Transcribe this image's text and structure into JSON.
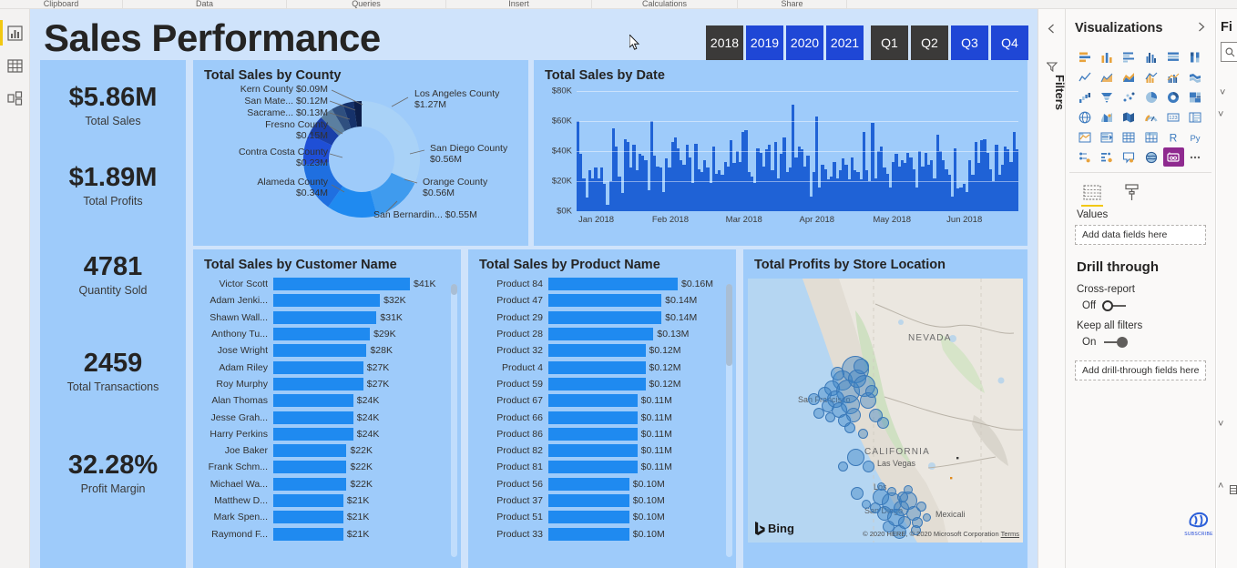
{
  "ribbon": {
    "groups": [
      "Clipboard",
      "Data",
      "Queries",
      "Insert",
      "Calculations",
      "Share"
    ]
  },
  "left_rail": {
    "items": [
      {
        "name": "report-view",
        "icon": "bar-chart-icon",
        "selected": true
      },
      {
        "name": "data-view",
        "icon": "table-icon",
        "selected": false
      },
      {
        "name": "model-view",
        "icon": "relationships-icon",
        "selected": false
      }
    ]
  },
  "report": {
    "title": "Sales Performance",
    "year_slicer": {
      "options": [
        "2018",
        "2019",
        "2020",
        "2021"
      ],
      "selected": [
        "2018"
      ]
    },
    "quarter_slicer": {
      "options": [
        "Q1",
        "Q2",
        "Q3",
        "Q4"
      ],
      "selected": [
        "Q1",
        "Q2"
      ]
    },
    "kpis": [
      {
        "value": "$5.86M",
        "label": "Total Sales"
      },
      {
        "value": "$1.89M",
        "label": "Total Profits"
      },
      {
        "value": "4781",
        "label": "Quantity Sold"
      },
      {
        "value": "2459",
        "label": "Total Transactions"
      },
      {
        "value": "32.28%",
        "label": "Profit Margin"
      }
    ]
  },
  "chart_data": [
    {
      "type": "pie",
      "title": "Total Sales by County",
      "labels": [
        "Los Angeles County",
        "San Diego County",
        "Orange County",
        "San Bernardin...",
        "Alameda County",
        "Contra Costa County",
        "Fresno County",
        "Sacrame...",
        "San Mate...",
        "Kern County"
      ],
      "value_labels": [
        "$1.27M",
        "$0.56M",
        "$0.56M",
        "$0.55M",
        "$0.34M",
        "$0.23M",
        "$0.15M",
        "$0.13M",
        "$0.12M",
        "$0.09M"
      ],
      "values": [
        1.27,
        0.56,
        0.56,
        0.55,
        0.34,
        0.23,
        0.15,
        0.13,
        0.12,
        0.09
      ],
      "unit": "M",
      "colors": [
        "#a9d2f7",
        "#3f9bee",
        "#1f8af0",
        "#1f6fe0",
        "#1f4fd6",
        "#1a3fa8",
        "#5b7fa0",
        "#2f4f7f",
        "#16326b",
        "#0d1f4a"
      ],
      "legend": "labels-outside"
    },
    {
      "type": "bar",
      "title": "Total Sales by Date",
      "xlabel": "",
      "ylabel": "",
      "ylim": [
        0,
        80000
      ],
      "ytick_labels": [
        "$0K",
        "$20K",
        "$40K",
        "$60K",
        "$80K"
      ],
      "ytick_values": [
        0,
        20000,
        40000,
        60000,
        80000
      ],
      "xtick_labels": [
        "Jan 2018",
        "Feb 2018",
        "Mar 2018",
        "Apr 2018",
        "May 2018",
        "Jun 2018"
      ],
      "grid": true,
      "bar_color": "#1f62d6",
      "values": [
        60000,
        38000,
        22000,
        9000,
        27000,
        22000,
        29000,
        22000,
        29000,
        18000,
        4000,
        20000,
        55000,
        43000,
        23000,
        12000,
        48000,
        46000,
        29000,
        44000,
        27000,
        38000,
        37000,
        34000,
        14000,
        60000,
        37000,
        30000,
        29000,
        13000,
        35000,
        29000,
        46000,
        49000,
        42000,
        34000,
        31000,
        44000,
        36000,
        19000,
        45000,
        28000,
        26000,
        34000,
        29000,
        19000,
        43000,
        25000,
        27000,
        24000,
        33000,
        30000,
        47000,
        32000,
        40000,
        33000,
        53000,
        54000,
        26000,
        23000,
        19000,
        42000,
        39000,
        30000,
        41000,
        44000,
        27000,
        46000,
        22000,
        38000,
        49000,
        26000,
        29000,
        71000,
        36000,
        43000,
        41000,
        30000,
        37000,
        10000,
        26000,
        63000,
        16000,
        31000,
        28000,
        21000,
        23000,
        33000,
        22000,
        27000,
        35000,
        31000,
        21000,
        36000,
        27000,
        26000,
        21000,
        53000,
        27000,
        20000,
        59000,
        22000,
        40000,
        43000,
        29000,
        25000,
        16000,
        33000,
        38000,
        30000,
        34000,
        32000,
        39000,
        36000,
        28000,
        16000,
        40000,
        30000,
        39000,
        31000,
        34000,
        22000,
        51000,
        40000,
        34000,
        28000,
        24000,
        10000,
        42000,
        15000,
        16000,
        18000,
        13000,
        34000,
        24000,
        46000,
        32000,
        47000,
        48000,
        39000,
        28000,
        20000,
        44000,
        24000,
        31000,
        43000,
        41000,
        33000,
        53000,
        41000
      ]
    },
    {
      "type": "bar",
      "orientation": "horizontal",
      "title": "Total Sales by Customer Name",
      "categories": [
        "Victor Scott",
        "Adam Jenki...",
        "Shawn Wall...",
        "Anthony Tu...",
        "Jose Wright",
        "Adam Riley",
        "Roy Murphy",
        "Alan Thomas",
        "Jesse Grah...",
        "Harry Perkins",
        "Joe Baker",
        "Frank Schm...",
        "Michael Wa...",
        "Matthew D...",
        "Mark Spen...",
        "Raymond F..."
      ],
      "values": [
        41,
        32,
        31,
        29,
        28,
        27,
        27,
        24,
        24,
        24,
        22,
        22,
        22,
        21,
        21,
        21
      ],
      "value_labels": [
        "$41K",
        "$32K",
        "$31K",
        "$29K",
        "$28K",
        "$27K",
        "$27K",
        "$24K",
        "$24K",
        "$24K",
        "$22K",
        "$22K",
        "$22K",
        "$21K",
        "$21K",
        "$21K"
      ],
      "unit": "K",
      "bar_color": "#1f8af0"
    },
    {
      "type": "bar",
      "orientation": "horizontal",
      "title": "Total Sales by Product Name",
      "categories": [
        "Product 84",
        "Product 47",
        "Product 29",
        "Product 28",
        "Product 32",
        "Product 4",
        "Product 59",
        "Product 67",
        "Product 66",
        "Product 86",
        "Product 82",
        "Product 81",
        "Product 56",
        "Product 37",
        "Product 51",
        "Product 33"
      ],
      "values": [
        0.16,
        0.14,
        0.14,
        0.13,
        0.12,
        0.12,
        0.12,
        0.11,
        0.11,
        0.11,
        0.11,
        0.11,
        0.1,
        0.1,
        0.1,
        0.1
      ],
      "value_labels": [
        "$0.16M",
        "$0.14M",
        "$0.14M",
        "$0.13M",
        "$0.12M",
        "$0.12M",
        "$0.12M",
        "$0.11M",
        "$0.11M",
        "$0.11M",
        "$0.11M",
        "$0.11M",
        "$0.10M",
        "$0.10M",
        "$0.10M",
        "$0.10M"
      ],
      "unit": "M",
      "bar_color": "#1f8af0"
    },
    {
      "type": "scatter",
      "subtype": "bubble-map",
      "title": "Total Profits by Store Location",
      "region": "California / Nevada",
      "city_labels": [
        "San Francisco",
        "Los",
        "San Diego",
        "Las Vegas",
        "Mexicali"
      ],
      "state_labels": [
        "NEVADA",
        "CALIFORNIA"
      ],
      "provider": "Bing",
      "attribution": "© 2020 HERE, © 2020 Microsoft Corporation",
      "terms_label": "Terms",
      "bubble_color": "#3880c4"
    }
  ],
  "visualizations_pane": {
    "title": "Visualizations",
    "expand_icon": "chevron-right-icon",
    "collapse_icon": "chevron-left-icon",
    "filters_label": "Filters",
    "filter_icon": "filter-funnel-icon",
    "gallery": [
      "stacked-bar-chart-icon",
      "stacked-column-chart-icon",
      "clustered-bar-chart-icon",
      "clustered-column-chart-icon",
      "100-stacked-bar-chart-icon",
      "100-stacked-column-chart-icon",
      "line-chart-icon",
      "area-chart-icon",
      "stacked-area-chart-icon",
      "line-stacked-column-chart-icon",
      "line-clustered-column-chart-icon",
      "ribbon-chart-icon",
      "waterfall-chart-icon",
      "funnel-icon",
      "scatter-chart-icon",
      "pie-chart-icon",
      "donut-chart-icon",
      "treemap-icon",
      "map-icon",
      "filled-map-icon",
      "shape-map-icon",
      "gauge-icon",
      "card-icon",
      "multi-row-card-icon",
      "kpi-icon",
      "slicer-icon",
      "table-icon",
      "matrix-icon",
      "r-visual-icon",
      "py-visual-icon",
      "key-influencers-icon",
      "decomposition-tree-icon",
      "qa-visual-icon",
      "smart-narrative-icon",
      "paginated-report-icon",
      "more-options-icon"
    ],
    "active_gallery_index": 34,
    "tabs": [
      {
        "name": "fields-tab",
        "icon": "fields-grid-icon",
        "selected": true
      },
      {
        "name": "format-tab",
        "icon": "paint-roller-icon",
        "selected": false
      }
    ],
    "values_label": "Values",
    "values_placeholder": "Add data fields here",
    "drill_through_title": "Drill through",
    "cross_report_label": "Cross-report",
    "cross_report_state": "Off",
    "keep_all_filters_label": "Keep all filters",
    "keep_all_filters_state": "On",
    "drill_placeholder": "Add drill-through fields here"
  },
  "fields_pane": {
    "title": "Fi",
    "search_icon": "search-icon"
  },
  "watermark": {
    "text": "SUBSCRIBE"
  }
}
